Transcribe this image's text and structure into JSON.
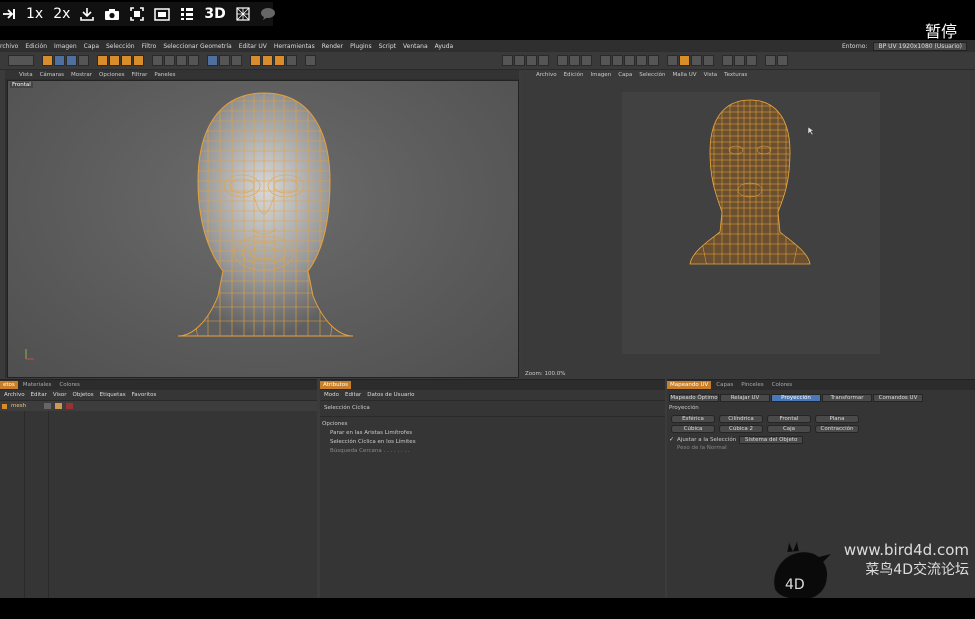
{
  "player": {
    "speed1": "1x",
    "speed2": "2x",
    "mode3d": "3D",
    "pause_label": "暂停"
  },
  "menubar": {
    "items": [
      "rchivo",
      "Edición",
      "Imagen",
      "Capa",
      "Selección",
      "Filtro",
      "Seleccionar Geometría",
      "Editar UV",
      "Herramientas",
      "Render",
      "Plugins",
      "Script",
      "Ventana",
      "Ayuda"
    ],
    "env_label": "Entorno:",
    "env_value": "BP UV 1920x1080 (Usuario)"
  },
  "viewport_left": {
    "menu": [
      "Vista",
      "Cámaras",
      "Mostrar",
      "Opciones",
      "Filtrar",
      "Paneles"
    ],
    "label": "Frontal"
  },
  "viewport_right": {
    "menu": [
      "Archivo",
      "Edición",
      "Imagen",
      "Capa",
      "Selección",
      "Malla UV",
      "Vista",
      "Texturas"
    ],
    "zoom": "Zoom: 100.0%"
  },
  "objects_panel": {
    "tabs": [
      "etos",
      "Materiales",
      "Colores"
    ],
    "menu": [
      "Archivo",
      "Editar",
      "Visor",
      "Objetos",
      "Etiquetas",
      "Favoritos"
    ],
    "object_name": "mesh"
  },
  "attributes_panel": {
    "tab": "Atributos",
    "menu": [
      "Modo",
      "Editar",
      "Datos de Usuario"
    ],
    "title": "Selección Cíclica",
    "section": "Opciones",
    "options": [
      "Parar en las Aristas Limítrofes",
      "Selección Cíclica en los Límites",
      "Búsqueda Cercana . . . . . . . ."
    ]
  },
  "uv_panel": {
    "tabs": [
      "Mapeando UV",
      "Capas",
      "Pinceles",
      "Colores"
    ],
    "subtabs": [
      "Mapeado Óptimo",
      "Relajar UV",
      "Proyección",
      "Transformar",
      "Comandos UV"
    ],
    "section": "Proyección",
    "buttons_row1": [
      "Esférica",
      "Cilíndrica",
      "Frontal",
      "Plana"
    ],
    "buttons_row2": [
      "Cúbica",
      "Cúbica 2",
      "Caja",
      "Contracción"
    ],
    "fit_label": "Ajustar a la Selección",
    "fit_value": "Sistema del Objeto",
    "normal_label": "Peso de la Normal"
  },
  "watermark": {
    "url": "www.bird4d.com",
    "name": "菜鸟4D交流论坛",
    "logo_text": "4D"
  },
  "colors": {
    "accent": "#d98c2a",
    "wire": "#e8a23a",
    "blue": "#4b78b8"
  }
}
